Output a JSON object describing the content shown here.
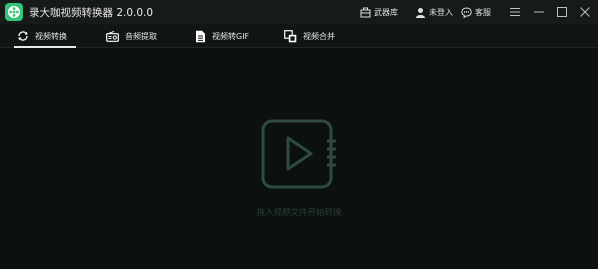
{
  "app": {
    "title": "录大咖视频转换器 2.0.0.0",
    "logo_icon": "film-reel-logo",
    "accent": "#35c37a"
  },
  "titlebar": {
    "arsenal": {
      "label": "武器库",
      "icon": "toolbox-icon"
    },
    "login": {
      "label": "未登入",
      "icon": "user-icon"
    },
    "support": {
      "label": "客服",
      "icon": "chat-bubble-icon"
    },
    "window_controls": [
      "menu-icon",
      "minimize-icon",
      "maximize-icon",
      "close-icon"
    ]
  },
  "tabs": [
    {
      "label": "视频转换",
      "icon": "convert-icon",
      "active": true
    },
    {
      "label": "音频提取",
      "icon": "radio-icon",
      "active": false
    },
    {
      "label": "视频转GIF",
      "icon": "document-icon",
      "active": false
    },
    {
      "label": "视频合并",
      "icon": "merge-icon",
      "active": false
    }
  ],
  "dropzone": {
    "hint": "拖入视频文件开始转换",
    "icon": "video-play-icon",
    "icon_color": "#2f4a40"
  }
}
